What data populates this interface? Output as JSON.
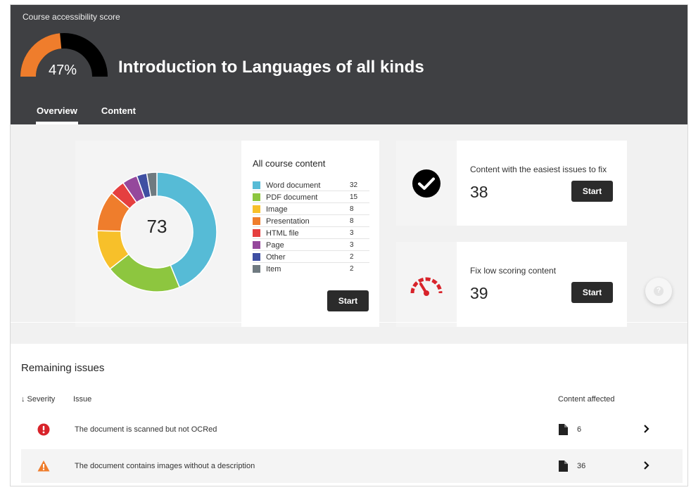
{
  "header": {
    "score_label": "Course accessibility score",
    "score_percent": "47%",
    "score_value": 47,
    "course_title": "Introduction to Languages of all kinds",
    "tabs": [
      {
        "label": "Overview",
        "active": true
      },
      {
        "label": "Content",
        "active": false
      }
    ]
  },
  "content_overview": {
    "total": "73",
    "title": "All course content",
    "start_label": "Start",
    "items": [
      {
        "label": "Word document",
        "count": "32",
        "color": "#56bbd6"
      },
      {
        "label": "PDF document",
        "count": "15",
        "color": "#8dc63f"
      },
      {
        "label": "Image",
        "count": "8",
        "color": "#f7c02a"
      },
      {
        "label": "Presentation",
        "count": "8",
        "color": "#ef7d2c"
      },
      {
        "label": "HTML file",
        "count": "3",
        "color": "#e53f3f"
      },
      {
        "label": "Page",
        "count": "3",
        "color": "#95489c"
      },
      {
        "label": "Other",
        "count": "2",
        "color": "#3f4fa2"
      },
      {
        "label": "Item",
        "count": "2",
        "color": "#6f7a80"
      }
    ]
  },
  "easy_fixes": {
    "title": "Content with the easiest issues to fix",
    "count": "38",
    "start_label": "Start",
    "icon": "check-circle-icon"
  },
  "low_scoring": {
    "title": "Fix low scoring content",
    "count": "39",
    "start_label": "Start",
    "icon": "speedometer-icon"
  },
  "help": {
    "label": "?"
  },
  "issues": {
    "title": "Remaining issues",
    "columns": {
      "severity": "↓ Severity",
      "issue": "Issue",
      "affected": "Content affected"
    },
    "rows": [
      {
        "severity": "severe",
        "icon": "error-icon",
        "text": "The document is scanned but not OCRed",
        "count": "6"
      },
      {
        "severity": "major",
        "icon": "warning-icon",
        "text": "The document contains images without a description",
        "count": "36"
      }
    ]
  },
  "colors": {
    "header_bg": "#3f4043",
    "gauge_fill": "#ef7d2c",
    "button_bg": "#2b2b2b",
    "error": "#d8232a",
    "warning": "#ef7d2c"
  }
}
